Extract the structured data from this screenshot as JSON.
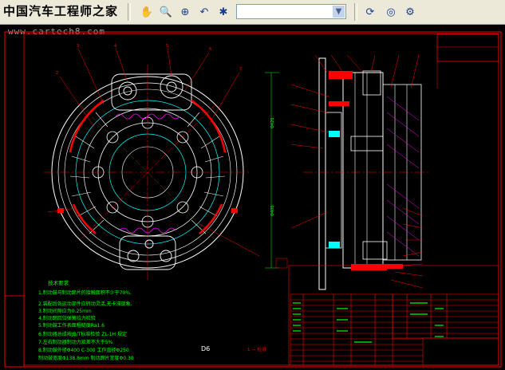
{
  "toolbar": {
    "site_title": "中国汽车工程师之家",
    "buttons": [
      {
        "name": "pan-icon",
        "glyph": "✋"
      },
      {
        "name": "zoom-realtime-icon",
        "glyph": "🔍"
      },
      {
        "name": "zoom-window-icon",
        "glyph": "⊕"
      },
      {
        "name": "zoom-previous-icon",
        "glyph": "↶"
      },
      {
        "name": "named-views-icon",
        "glyph": "✱"
      },
      {
        "name": "orbit-icon",
        "glyph": "⟳"
      },
      {
        "name": "properties-icon",
        "glyph": "⚙"
      }
    ],
    "layer_value": ""
  },
  "watermark_url": "www.cartech8.com",
  "drawing": {
    "mark_d6": "D6",
    "notes_title": "技术要求",
    "notes": [
      "1.制动鼓与制动蹄片的接触面积不少于70%.",
      "2.装配后各运动部件应转动灵活,无卡滞现象.",
      "3.制动间隙应为0.25mm",
      "4.制动蹄回位弹簧拉力检验",
      "5.制动鼓工作表面粗糙度Ra1.6",
      "6.制动器总成按JB/T标准检验 ZL-1H 规定",
      "7.左右制动器制动力矩差不大于5%",
      "8.制动鼓外径Φ400  C-300 工作直径Φ250",
      "  制动鼓宽度Φ138.8mm 制动蹄片宽度Φ0.30"
    ],
    "legend_mark": "1 — 检测"
  },
  "colors": {
    "background": "#000000",
    "frame": "#ff0000",
    "geometry": "#ffffff",
    "centerline": "#ff0000",
    "dimension": "#00ff00",
    "hatch": "#ff00ff",
    "balloon": "#ff0000"
  }
}
